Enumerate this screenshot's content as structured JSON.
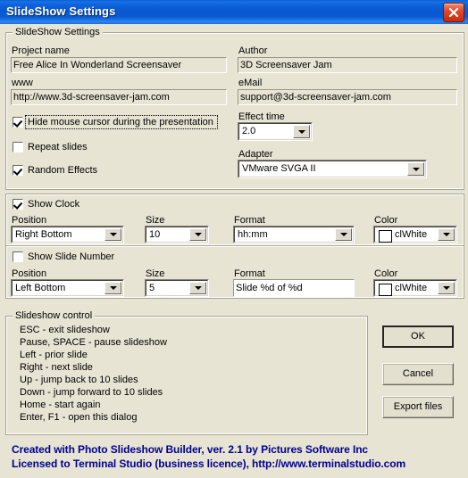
{
  "window": {
    "title": "SlideShow Settings",
    "close_icon": "close-icon"
  },
  "settings_group": {
    "legend": "SlideShow Settings",
    "project_name": {
      "label": "Project name",
      "value": "Free Alice In Wonderland Screensaver"
    },
    "www": {
      "label": "www",
      "value": "http://www.3d-screensaver-jam.com"
    },
    "author": {
      "label": "Author",
      "value": "3D Screensaver Jam"
    },
    "email": {
      "label": "eMail",
      "value": "support@3d-screensaver-jam.com"
    },
    "effect_time": {
      "label": "Effect time",
      "value": "2.0"
    },
    "adapter": {
      "label": "Adapter",
      "value": "VMware SVGA II"
    },
    "checkboxes": [
      {
        "label": "Hide mouse cursor during the presentation",
        "checked": true,
        "focused": true
      },
      {
        "label": "Repeat slides",
        "checked": false,
        "focused": false
      },
      {
        "label": "Random Effects",
        "checked": true,
        "focused": false
      }
    ]
  },
  "clock_panel": {
    "toggle": {
      "label": "Show Clock",
      "checked": true
    },
    "position": {
      "label": "Position",
      "value": "Right Bottom"
    },
    "size": {
      "label": "Size",
      "value": "10"
    },
    "format": {
      "label": "Format",
      "value": "hh:mm"
    },
    "color": {
      "label": "Color",
      "value": "clWhite",
      "swatch": "#ffffff"
    }
  },
  "slide_number_panel": {
    "toggle": {
      "label": "Show Slide Number",
      "checked": false
    },
    "position": {
      "label": "Position",
      "value": "Left Bottom"
    },
    "size": {
      "label": "Size",
      "value": "5"
    },
    "format": {
      "label": "Format",
      "value": "Slide %d of %d"
    },
    "color": {
      "label": "Color",
      "value": "clWhite",
      "swatch": "#ffffff"
    }
  },
  "control_group": {
    "legend": "Slideshow control",
    "lines": [
      "ESC - exit slideshow",
      "Pause, SPACE - pause slideshow",
      "Left - prior slide",
      "Right - next slide",
      "Up - jump back to 10 slides",
      "Down - jump forward to 10 slides",
      "Home - start again",
      "Enter, F1 - open this dialog"
    ]
  },
  "buttons": {
    "ok": "OK",
    "cancel": "Cancel",
    "export": "Export files"
  },
  "footer": {
    "line1": "Created with Photo Slideshow Builder, ver. 2.1   by Pictures Software Inc",
    "line2": "Licensed to Terminal Studio (business licence), http://www.terminalstudio.com",
    "color": "#00008f"
  }
}
